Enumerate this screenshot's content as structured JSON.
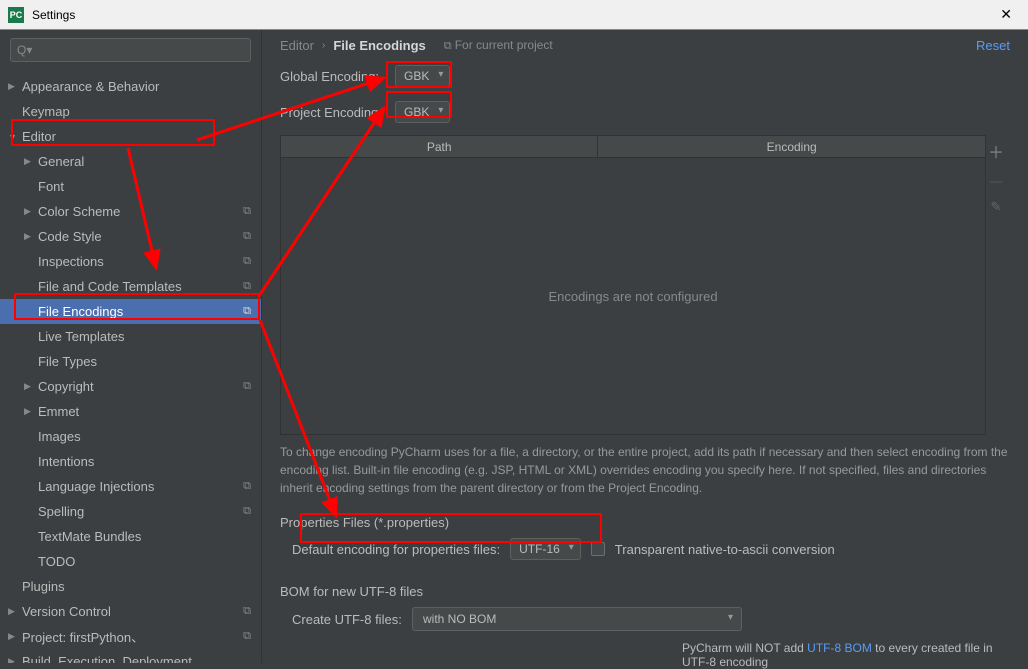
{
  "window": {
    "title": "Settings"
  },
  "search": {
    "placeholder": "Q▾"
  },
  "sidebar": {
    "items": [
      {
        "label": "Appearance & Behavior",
        "level": 0,
        "arrow": "▶",
        "gear": false
      },
      {
        "label": "Keymap",
        "level": 0,
        "arrow": "",
        "gear": false
      },
      {
        "label": "Editor",
        "level": 0,
        "arrow": "▼",
        "gear": false
      },
      {
        "label": "General",
        "level": 1,
        "arrow": "▶",
        "gear": false
      },
      {
        "label": "Font",
        "level": 1,
        "arrow": "",
        "gear": false
      },
      {
        "label": "Color Scheme",
        "level": 1,
        "arrow": "▶",
        "gear": true
      },
      {
        "label": "Code Style",
        "level": 1,
        "arrow": "▶",
        "gear": true
      },
      {
        "label": "Inspections",
        "level": 1,
        "arrow": "",
        "gear": true
      },
      {
        "label": "File and Code Templates",
        "level": 1,
        "arrow": "",
        "gear": true
      },
      {
        "label": "File Encodings",
        "level": 1,
        "arrow": "",
        "gear": true,
        "selected": true
      },
      {
        "label": "Live Templates",
        "level": 1,
        "arrow": "",
        "gear": false
      },
      {
        "label": "File Types",
        "level": 1,
        "arrow": "",
        "gear": false
      },
      {
        "label": "Copyright",
        "level": 1,
        "arrow": "▶",
        "gear": true
      },
      {
        "label": "Emmet",
        "level": 1,
        "arrow": "▶",
        "gear": false
      },
      {
        "label": "Images",
        "level": 1,
        "arrow": "",
        "gear": false
      },
      {
        "label": "Intentions",
        "level": 1,
        "arrow": "",
        "gear": false
      },
      {
        "label": "Language Injections",
        "level": 1,
        "arrow": "",
        "gear": true
      },
      {
        "label": "Spelling",
        "level": 1,
        "arrow": "",
        "gear": true
      },
      {
        "label": "TextMate Bundles",
        "level": 1,
        "arrow": "",
        "gear": false
      },
      {
        "label": "TODO",
        "level": 1,
        "arrow": "",
        "gear": false
      },
      {
        "label": "Plugins",
        "level": 0,
        "arrow": "",
        "gear": false
      },
      {
        "label": "Version Control",
        "level": 0,
        "arrow": "▶",
        "gear": true
      },
      {
        "label": "Project: firstPython、",
        "level": 0,
        "arrow": "▶",
        "gear": true
      },
      {
        "label": "Build, Execution, Deployment",
        "level": 0,
        "arrow": "▶",
        "gear": false
      }
    ]
  },
  "breadcrumb": {
    "root": "Editor",
    "sep": "›",
    "current": "File Encodings"
  },
  "header": {
    "project_scope": "For current project",
    "reset": "Reset"
  },
  "encodings": {
    "global_label": "Global Encoding:",
    "global_value": "GBK",
    "project_label": "Project Encoding:",
    "project_value": "GBK"
  },
  "table": {
    "col_path": "Path",
    "col_encoding": "Encoding",
    "empty": "Encodings are not configured"
  },
  "help": "To change encoding PyCharm uses for a file, a directory, or the entire project, add its path if necessary and then select encoding from the encoding list. Built-in file encoding (e.g. JSP, HTML or XML) overrides encoding you specify here. If not specified, files and directories inherit encoding settings from the parent directory or from the Project Encoding.",
  "properties": {
    "section": "Properties Files (*.properties)",
    "default_label": "Default encoding for properties files:",
    "default_value": "UTF-16",
    "transparent": "Transparent native-to-ascii conversion"
  },
  "bom": {
    "section": "BOM for new UTF-8 files",
    "create_label": "Create UTF-8 files:",
    "create_value": "with NO BOM",
    "note_pre": "PyCharm will NOT add ",
    "note_link": "UTF-8 BOM",
    "note_post": " to every created file in UTF-8 encoding"
  }
}
